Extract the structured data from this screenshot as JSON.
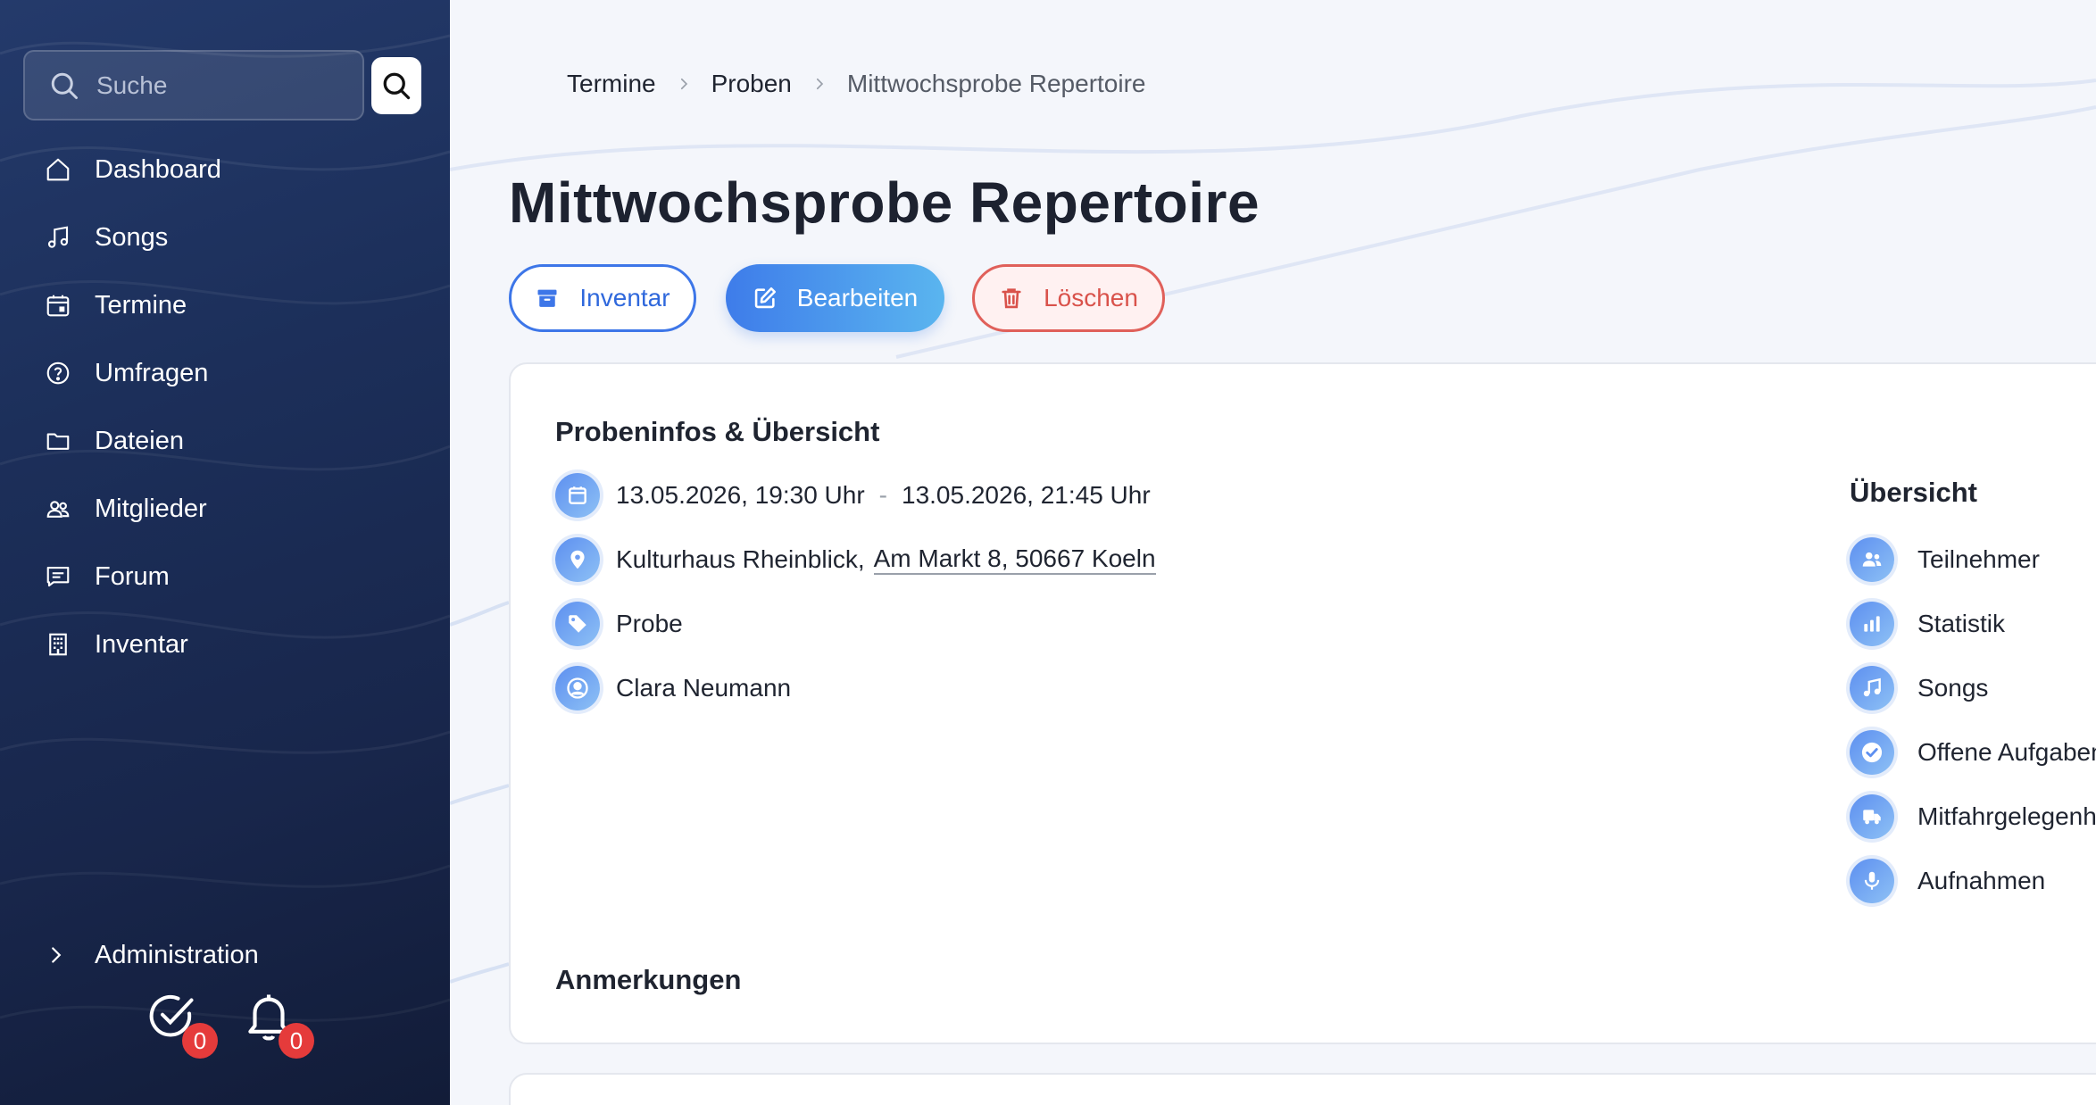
{
  "sidebar": {
    "search_placeholder": "Suche",
    "items": [
      {
        "label": "Dashboard",
        "icon": "home-icon"
      },
      {
        "label": "Songs",
        "icon": "music-note-icon"
      },
      {
        "label": "Termine",
        "icon": "calendar-icon"
      },
      {
        "label": "Umfragen",
        "icon": "question-circle-icon"
      },
      {
        "label": "Dateien",
        "icon": "folder-icon"
      },
      {
        "label": "Mitglieder",
        "icon": "users-icon"
      },
      {
        "label": "Forum",
        "icon": "chat-icon"
      },
      {
        "label": "Inventar",
        "icon": "building-icon"
      }
    ],
    "admin_label": "Administration",
    "tasks_badge": "0",
    "notifications_badge": "0"
  },
  "breadcrumb": {
    "items": [
      "Termine",
      "Proben"
    ],
    "current": "Mittwochsprobe Repertoire"
  },
  "page": {
    "title": "Mittwochsprobe Repertoire",
    "buttons": {
      "inventar": "Inventar",
      "edit": "Bearbeiten",
      "delete": "Löschen"
    }
  },
  "info": {
    "section_title": "Probeninfos & Übersicht",
    "start": "13.05.2026, 19:30 Uhr",
    "separator": "-",
    "end": "13.05.2026, 21:45 Uhr",
    "venue": "Kulturhaus Rheinblick,",
    "address": "Am Markt 8, 50667 Koeln",
    "type": "Probe",
    "person": "Clara Neumann"
  },
  "overview": {
    "title": "Übersicht",
    "items": [
      {
        "label": "Teilnehmer",
        "icon": "participants-icon"
      },
      {
        "label": "Statistik",
        "icon": "bar-chart-icon"
      },
      {
        "label": "Songs",
        "icon": "music-note-icon"
      },
      {
        "label": "Offene Aufgaben",
        "icon": "check-circle-icon"
      },
      {
        "label": "Mitfahrgelegenheiten",
        "icon": "truck-icon"
      },
      {
        "label": "Aufnahmen",
        "icon": "microphone-icon"
      }
    ]
  },
  "notes": {
    "title": "Anmerkungen"
  },
  "colors": {
    "sidebar_top": "#243a6b",
    "sidebar_bottom": "#121c38",
    "accent_blue": "#3d76e8",
    "danger_red": "#e0605a",
    "badge_red": "#e53b3b"
  }
}
